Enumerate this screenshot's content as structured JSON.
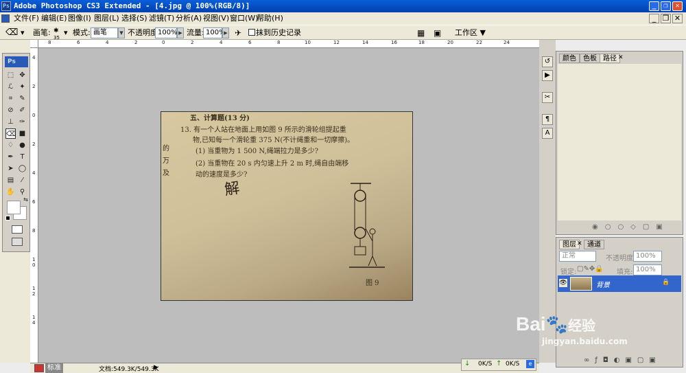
{
  "title": {
    "logo": "Ps",
    "text": "Adobe Photoshop CS3 Extended - [4.jpg @ 100%(RGB/8)]",
    "min": "_",
    "restore": "❐",
    "close": "✕"
  },
  "menu": [
    "文件(F)",
    "编辑(E)",
    "图像(I)",
    "图层(L)",
    "选择(S)",
    "滤镜(T)",
    "分析(A)",
    "视图(V)",
    "窗口(W)",
    "帮助(H)"
  ],
  "doc_controls": {
    "min": "_",
    "restore": "❐",
    "close": "✕"
  },
  "options": {
    "brush_label": "画笔:",
    "brush_size": "35",
    "mode_label": "模式:",
    "mode_value": "画笔",
    "opacity_label": "不透明度:",
    "opacity_value": "100%",
    "flow_label": "流量:",
    "flow_value": "100%",
    "history_label": "抹到历史记录",
    "workspace_label": "工作区 ▼"
  },
  "ruler_top": [
    "8",
    "6",
    "4",
    "2",
    "0",
    "2",
    "4",
    "6",
    "8",
    "10",
    "12",
    "14",
    "16",
    "18",
    "20",
    "22",
    "24"
  ],
  "ruler_left": [
    "4",
    "2",
    "0",
    "2",
    "4",
    "6",
    "8",
    "1 0",
    "1 2",
    "1 4"
  ],
  "canvas": {
    "lines": [
      "五、计算题(13 分)",
      "13. 有一个人站在地面上用如图 9 所示的滑轮组提起重",
      "物,已知每一个滑轮重 375 N(不计绳重和一切摩擦)。",
      "(1) 当重物为 1 500 N,绳端拉力是多少?",
      "(2) 当重物在 20 s 内匀速上升 2 m 时,绳自由端移",
      "动的速度是多少?"
    ],
    "handwriting": "解",
    "figure_label": "图 9",
    "left_margin": [
      "的",
      "万",
      "及"
    ]
  },
  "statusbar": {
    "zoom": "标准",
    "size": "文档:549.3K/549.3K"
  },
  "panel1": {
    "tabs": [
      "颜色",
      "色板",
      "路径"
    ]
  },
  "panel2": {
    "tabs": [
      "图层",
      "通道"
    ],
    "blend": "正常",
    "opacity_label": "不透明度:",
    "opacity_value": "100%",
    "lock_label": "锁定:",
    "fill_label": "填充:",
    "fill_value": "100%",
    "layer_name": "背景"
  },
  "taskbar": {
    "down": "0K/S",
    "up": "0K/S"
  },
  "watermark": {
    "brand": "Bai",
    "brand2": "经验",
    "url": "jingyan.baidu.com"
  },
  "colors": {
    "title": "#0a5fd8",
    "layer_selected": "#3366cc",
    "workspace": "#bdbdbd"
  }
}
